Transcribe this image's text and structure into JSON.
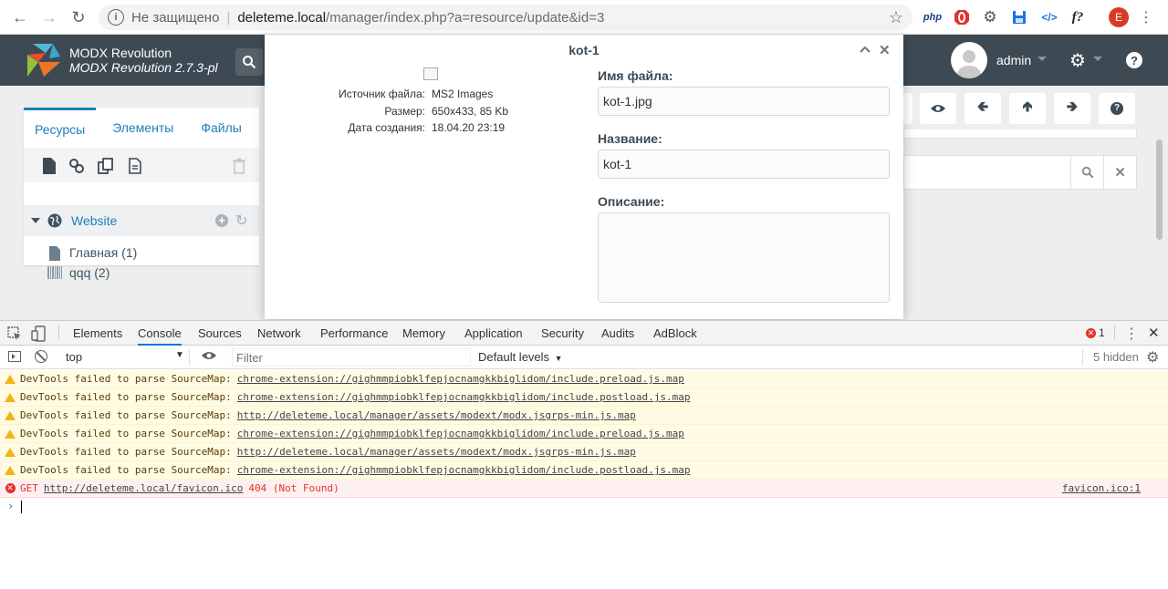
{
  "browser": {
    "security_text": "Не защищено",
    "url_host": "deleteme.local",
    "url_path": "/manager/index.php?a=resource/update&id=3",
    "profile_initial": "E",
    "ext_php": "php",
    "ext_fx": "f?"
  },
  "header": {
    "brand_title": "MODX Revolution",
    "brand_version": "MODX Revolution 2.7.3-pl",
    "username": "admin",
    "help_label": "?"
  },
  "tree": {
    "tabs": [
      {
        "label": "Ресурсы"
      },
      {
        "label": "Элементы"
      },
      {
        "label": "Файлы"
      }
    ],
    "root_label": "Website",
    "nodes": [
      {
        "label": "Главная (1)"
      },
      {
        "label": "qqq (2)"
      }
    ]
  },
  "modal": {
    "title": "kot-1",
    "info": {
      "source_label": "Источник файла:",
      "source_value": "MS2 Images",
      "size_label": "Размер:",
      "size_value": "650x433, 85 Kb",
      "date_label": "Дата создания:",
      "date_value": "18.04.20 23:19"
    },
    "fields": {
      "filename_label": "Имя файла:",
      "filename_value": "kot-1.jpg",
      "name_label": "Название:",
      "name_value": "kot-1",
      "description_label": "Описание:"
    }
  },
  "devtools": {
    "tabs": [
      {
        "label": "Elements"
      },
      {
        "label": "Console"
      },
      {
        "label": "Sources"
      },
      {
        "label": "Network"
      },
      {
        "label": "Performance"
      },
      {
        "label": "Memory"
      },
      {
        "label": "Application"
      },
      {
        "label": "Security"
      },
      {
        "label": "Audits"
      },
      {
        "label": "AdBlock"
      }
    ],
    "error_count": "1",
    "context": "top",
    "filter_placeholder": "Filter",
    "levels": "Default levels",
    "hidden": "5 hidden",
    "messages": [
      {
        "text": "DevTools failed to parse SourceMap:",
        "link": "chrome-extension://gighmmpiobklfepjocnamgkkbiglidom/include.preload.js.map"
      },
      {
        "text": "DevTools failed to parse SourceMap:",
        "link": "chrome-extension://gighmmpiobklfepjocnamgkkbiglidom/include.postload.js.map"
      },
      {
        "text": "DevTools failed to parse SourceMap:",
        "link": "http://deleteme.local/manager/assets/modext/modx.jsgrps-min.js.map"
      },
      {
        "text": "DevTools failed to parse SourceMap:",
        "link": "chrome-extension://gighmmpiobklfepjocnamgkkbiglidom/include.preload.js.map"
      },
      {
        "text": "DevTools failed to parse SourceMap:",
        "link": "http://deleteme.local/manager/assets/modext/modx.jsgrps-min.js.map"
      },
      {
        "text": "DevTools failed to parse SourceMap:",
        "link": "chrome-extension://gighmmpiobklfepjocnamgkkbiglidom/include.postload.js.map"
      }
    ],
    "error": {
      "method": "GET",
      "url": "http://deleteme.local/favicon.ico",
      "status": "404 (Not Found)",
      "source": "favicon.ico:1"
    }
  }
}
